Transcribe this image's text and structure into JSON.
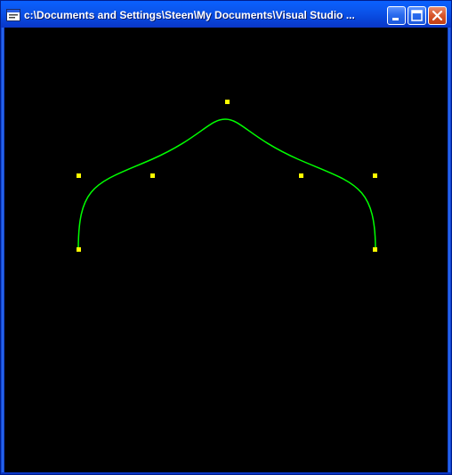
{
  "window": {
    "title": "c:\\Documents and Settings\\Steen\\My Documents\\Visual Studio ...",
    "buttons": {
      "minimize": "minimize-icon",
      "maximize": "maximize-icon",
      "close": "close-icon"
    }
  },
  "canvas": {
    "background_color": "#000000",
    "curve_color": "#00FF00",
    "control_point_color": "#FFFF00"
  }
}
